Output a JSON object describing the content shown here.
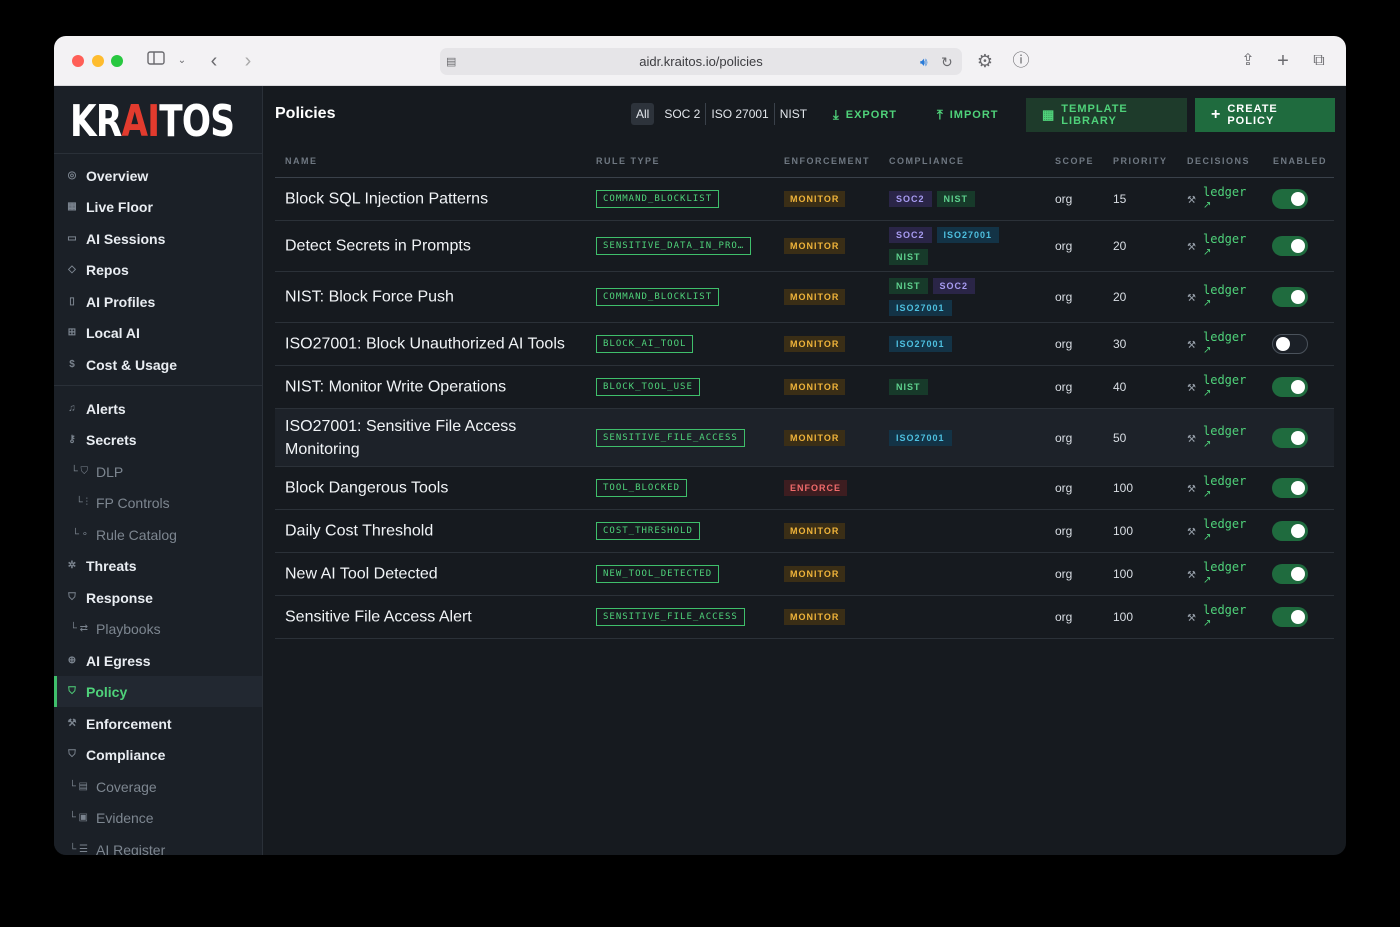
{
  "browser": {
    "url": "aidr.kraitos.io/policies"
  },
  "logo": {
    "pre": "KR",
    "ai": "AI",
    "post": "TOS"
  },
  "sidebar": {
    "items": [
      {
        "label": "Overview",
        "icon": "gauge-icon",
        "glyph": "◎",
        "sub": false
      },
      {
        "label": "Live Floor",
        "icon": "grid-icon",
        "glyph": "▦",
        "sub": false
      },
      {
        "label": "AI Sessions",
        "icon": "chat-icon",
        "glyph": "▭",
        "sub": false
      },
      {
        "label": "Repos",
        "icon": "git-icon",
        "glyph": "◇",
        "sub": false
      },
      {
        "label": "AI Profiles",
        "icon": "profile-icon",
        "glyph": "▯",
        "sub": false
      },
      {
        "label": "Local AI",
        "icon": "chip-icon",
        "glyph": "⊞",
        "sub": false
      },
      {
        "label": "Cost & Usage",
        "icon": "dollar-icon",
        "glyph": "$",
        "sub": false
      },
      {
        "label": "Alerts",
        "icon": "bell-icon",
        "glyph": "♫",
        "sub": false
      },
      {
        "label": "Secrets",
        "icon": "key-icon",
        "glyph": "⚷",
        "sub": false
      },
      {
        "label": "DLP",
        "icon": "shield-icon",
        "glyph": "⛉",
        "sub": true
      },
      {
        "label": "FP Controls",
        "icon": "sliders-icon",
        "glyph": "⫶",
        "sub": true
      },
      {
        "label": "Rule Catalog",
        "icon": "catalog-icon",
        "glyph": "∘",
        "sub": true
      },
      {
        "label": "Threats",
        "icon": "bug-icon",
        "glyph": "✲",
        "sub": false
      },
      {
        "label": "Response",
        "icon": "shield-icon",
        "glyph": "⛉",
        "sub": false
      },
      {
        "label": "Playbooks",
        "icon": "playbook-icon",
        "glyph": "⇄",
        "sub": true
      },
      {
        "label": "AI Egress",
        "icon": "globe-icon",
        "glyph": "⊕",
        "sub": false
      },
      {
        "label": "Policy",
        "icon": "shield-icon",
        "glyph": "⛉",
        "sub": false,
        "active": true
      },
      {
        "label": "Enforcement",
        "icon": "gavel-icon",
        "glyph": "⚒",
        "sub": false
      },
      {
        "label": "Compliance",
        "icon": "shield-icon",
        "glyph": "⛉",
        "sub": false
      },
      {
        "label": "Coverage",
        "icon": "clipboard-icon",
        "glyph": "▤",
        "sub": true
      },
      {
        "label": "Evidence",
        "icon": "folder-icon",
        "glyph": "▣",
        "sub": true
      },
      {
        "label": "AI Register",
        "icon": "list-icon",
        "glyph": "☰",
        "sub": true
      }
    ]
  },
  "header": {
    "title": "Policies",
    "filters": [
      "All",
      "SOC 2",
      "ISO 27001",
      "NIST"
    ],
    "export_label": "EXPORT",
    "import_label": "IMPORT",
    "template_label": "TEMPLATE LIBRARY",
    "create_label": "CREATE POLICY"
  },
  "table": {
    "columns": [
      "NAME",
      "RULE TYPE",
      "ENFORCEMENT",
      "COMPLIANCE",
      "SCOPE",
      "PRIORITY",
      "DECISIONS",
      "ENABLED"
    ],
    "rows": [
      {
        "name": "Block SQL Injection Patterns",
        "rule_type": "COMMAND_BLOCKLIST",
        "enforcement": "MONITOR",
        "compliance": [
          "SOC2",
          "NIST"
        ],
        "scope": "org",
        "priority": "15",
        "decisions": "ledger",
        "enabled": true
      },
      {
        "name": "Detect Secrets in Prompts",
        "rule_type": "SENSITIVE_DATA_IN_PRO…",
        "enforcement": "MONITOR",
        "compliance": [
          "SOC2",
          "ISO27001",
          "NIST"
        ],
        "scope": "org",
        "priority": "20",
        "decisions": "ledger",
        "enabled": true
      },
      {
        "name": "NIST: Block Force Push",
        "rule_type": "COMMAND_BLOCKLIST",
        "enforcement": "MONITOR",
        "compliance": [
          "NIST",
          "SOC2",
          "ISO27001"
        ],
        "scope": "org",
        "priority": "20",
        "decisions": "ledger",
        "enabled": true
      },
      {
        "name": "ISO27001: Block Unauthorized AI Tools",
        "rule_type": "BLOCK_AI_TOOL",
        "enforcement": "MONITOR",
        "compliance": [
          "ISO27001"
        ],
        "scope": "org",
        "priority": "30",
        "decisions": "ledger",
        "enabled": false
      },
      {
        "name": "NIST: Monitor Write Operations",
        "rule_type": "BLOCK_TOOL_USE",
        "enforcement": "MONITOR",
        "compliance": [
          "NIST"
        ],
        "scope": "org",
        "priority": "40",
        "decisions": "ledger",
        "enabled": true
      },
      {
        "name": "ISO27001: Sensitive File Access Monitoring",
        "rule_type": "SENSITIVE_FILE_ACCESS",
        "enforcement": "MONITOR",
        "compliance": [
          "ISO27001"
        ],
        "scope": "org",
        "priority": "50",
        "decisions": "ledger",
        "enabled": true,
        "highlight": true
      },
      {
        "name": "Block Dangerous Tools",
        "rule_type": "TOOL_BLOCKED",
        "enforcement": "ENFORCE",
        "compliance": [],
        "scope": "org",
        "priority": "100",
        "decisions": "ledger",
        "enabled": true
      },
      {
        "name": "Daily Cost Threshold",
        "rule_type": "COST_THRESHOLD",
        "enforcement": "MONITOR",
        "compliance": [],
        "scope": "org",
        "priority": "100",
        "decisions": "ledger",
        "enabled": true
      },
      {
        "name": "New AI Tool Detected",
        "rule_type": "NEW_TOOL_DETECTED",
        "enforcement": "MONITOR",
        "compliance": [],
        "scope": "org",
        "priority": "100",
        "decisions": "ledger",
        "enabled": true
      },
      {
        "name": "Sensitive File Access Alert",
        "rule_type": "SENSITIVE_FILE_ACCESS",
        "enforcement": "MONITOR",
        "compliance": [],
        "scope": "org",
        "priority": "100",
        "decisions": "ledger",
        "enabled": true
      }
    ]
  },
  "colors": {
    "accent": "#4fd27a",
    "background": "#161a1f",
    "sidebar": "#1b2027",
    "monitor": "#f0b43a",
    "enforce": "#f06b6b"
  }
}
